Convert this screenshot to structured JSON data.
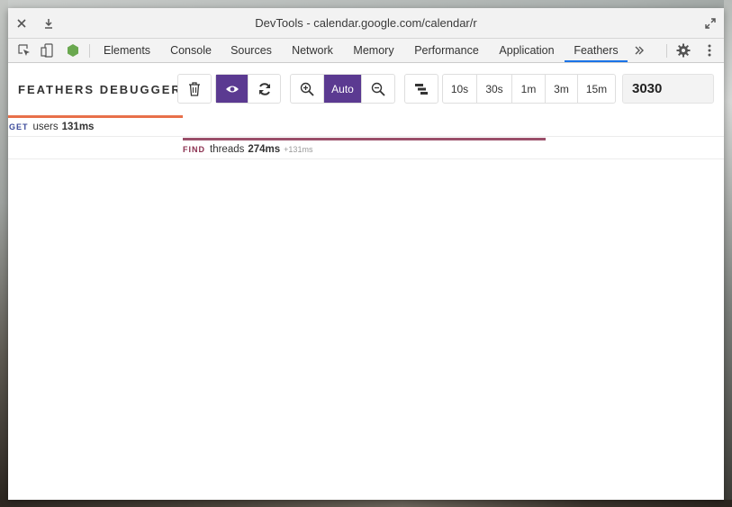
{
  "window": {
    "title": "DevTools - calendar.google.com/calendar/r"
  },
  "tabs": [
    {
      "label": "Elements",
      "active": false
    },
    {
      "label": "Console",
      "active": false
    },
    {
      "label": "Sources",
      "active": false
    },
    {
      "label": "Network",
      "active": false
    },
    {
      "label": "Memory",
      "active": false
    },
    {
      "label": "Performance",
      "active": false
    },
    {
      "label": "Application",
      "active": false
    },
    {
      "label": "Feathers",
      "active": true
    }
  ],
  "toolbar": {
    "brand": "FEATHERS DEBUGGER",
    "zoom_auto_label": "Auto",
    "time_ranges": [
      "10s",
      "30s",
      "1m",
      "3m",
      "15m"
    ],
    "port_value": "3030"
  },
  "requests": [
    {
      "method": "GET",
      "service": "users",
      "duration": "131ms",
      "offset": "",
      "color": "#3b4a9a",
      "bar_color": "#e8704a"
    },
    {
      "method": "FIND",
      "service": "threads",
      "duration": "274ms",
      "offset": "+131ms",
      "color": "#8a2f4f",
      "bar_color": "#9a4f6a"
    }
  ],
  "colors": {
    "accent": "#5b3a91",
    "tab_active": "#1a73e8"
  }
}
